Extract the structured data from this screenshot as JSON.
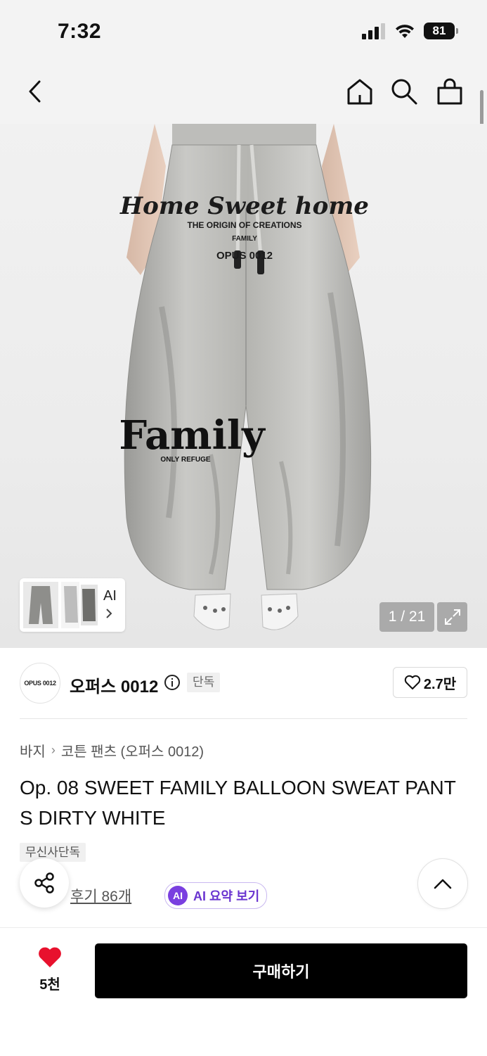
{
  "status_bar": {
    "time": "7:32",
    "battery": "81"
  },
  "nav": {
    "back_icon": "chevron-left-icon",
    "home_icon": "home-icon",
    "search_icon": "search-icon",
    "cart_icon": "shopping-bag-icon"
  },
  "gallery": {
    "print_top_line1": "Home Sweet home",
    "print_top_line2": "THE ORIGIN OF CREATIONS",
    "print_top_line3": "FAMILY",
    "print_top_line4": "OPUS 0012",
    "print_bottom_line1": "Family",
    "print_bottom_line2": "ONLY REFUGE",
    "ai_label": "AI",
    "counter": "1 / 21"
  },
  "brand": {
    "logo_text": "OPUS 0012",
    "name": "오퍼스 0012",
    "exclusive_badge": "단독",
    "likes": "2.7만"
  },
  "breadcrumb": {
    "category": "바지",
    "subcategory": "코튼 팬츠 (오퍼스 0012)"
  },
  "product": {
    "title": "Op. 08 SWEET FAMILY BALLOON SWEAT PANTS DIRTY WHITE",
    "store_badge": "무신사단독",
    "reviews": "후기 86개",
    "ai_badge": "AI",
    "ai_summary": "AI 요약 보기"
  },
  "bottom": {
    "wish_count": "5천",
    "buy_label": "구매하기"
  },
  "colors": {
    "accent_red": "#e8112d",
    "ai_purple": "#7a3fe0",
    "buy_black": "#000000"
  }
}
